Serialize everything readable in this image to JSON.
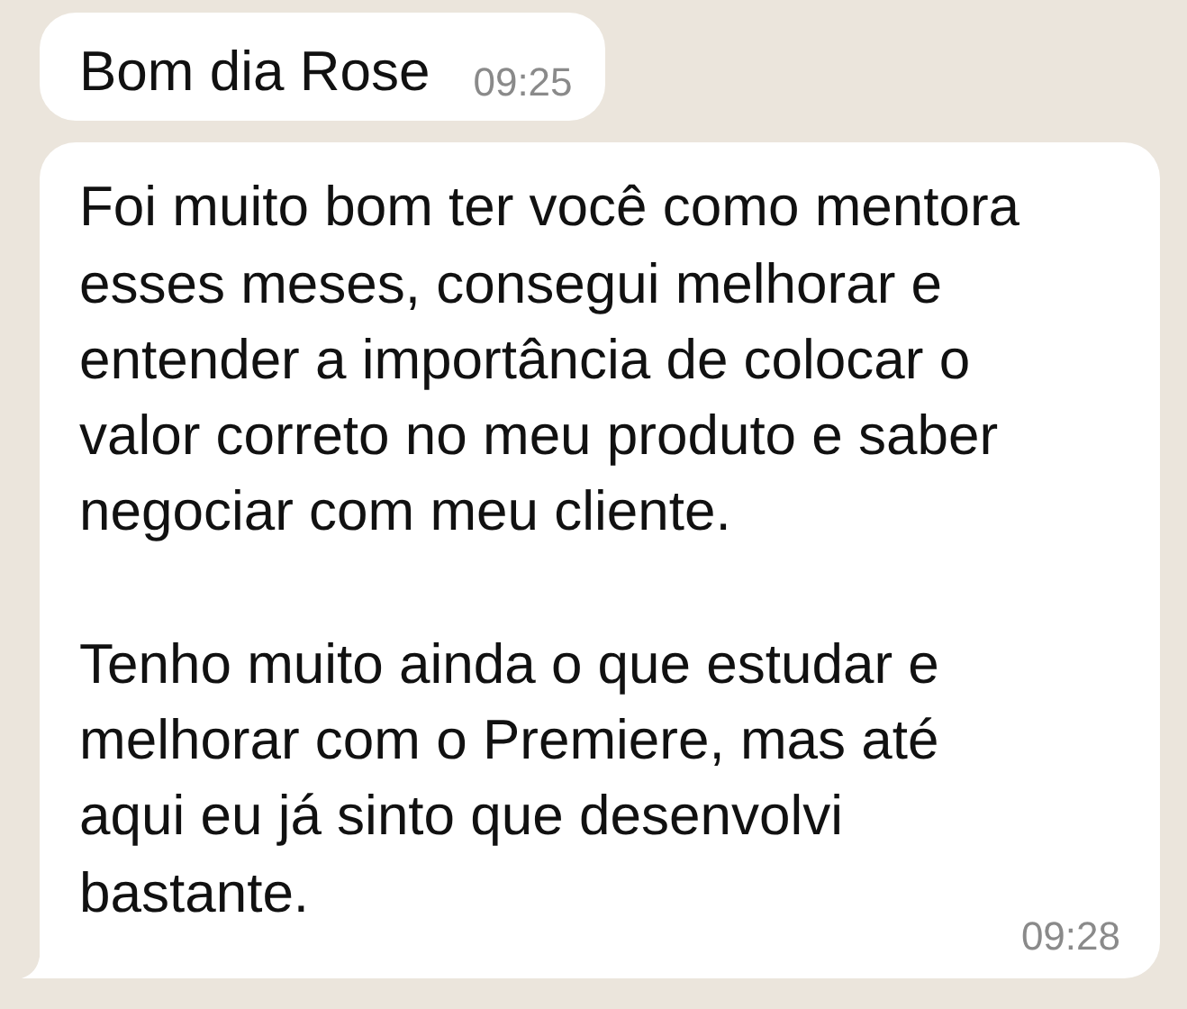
{
  "messages": [
    {
      "paragraphs": [
        [
          "Bom dia Rose"
        ]
      ],
      "time": "09:25",
      "tail": false
    },
    {
      "paragraphs": [
        [
          "Foi muito bom ter você como mentora",
          "esses meses, consegui melhorar e",
          "entender a importância de colocar o",
          "valor correto no meu produto e saber",
          "negociar com meu cliente."
        ],
        [
          "Tenho muito ainda o que estudar e",
          "melhorar com o Premiere, mas até",
          "aqui eu já sinto que desenvolvi",
          "bastante."
        ]
      ],
      "time": "09:28",
      "tail": true
    }
  ]
}
